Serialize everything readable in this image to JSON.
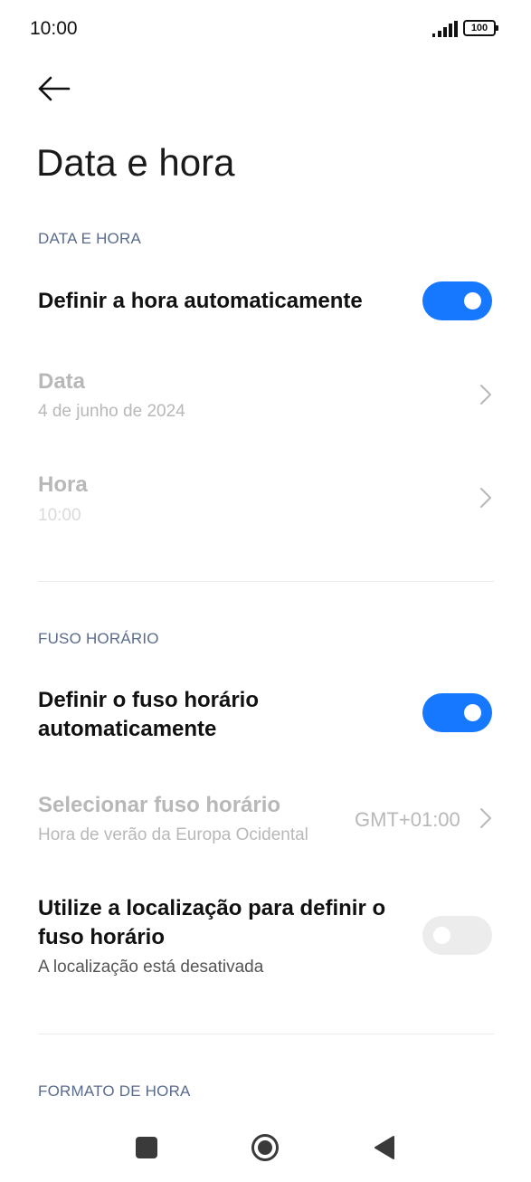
{
  "status_bar": {
    "time": "10:00",
    "battery": "100"
  },
  "page": {
    "title": "Data e hora"
  },
  "sections": {
    "date_time": {
      "header": "DATA E HORA",
      "auto_time": {
        "label": "Definir a hora automaticamente",
        "enabled": true
      },
      "date": {
        "label": "Data",
        "value": "4 de junho de 2024"
      },
      "time": {
        "label": "Hora",
        "value": "10:00"
      }
    },
    "time_zone": {
      "header": "FUSO HORÁRIO",
      "auto_zone": {
        "label_line1": "Definir o fuso horário",
        "label_line2": "automaticamente",
        "enabled": true
      },
      "select_zone": {
        "label": "Selecionar fuso horário",
        "sub": "Hora de verão da Europa Ocidental",
        "value": "GMT+01:00"
      },
      "use_location": {
        "label_line1": "Utilize a localização para definir o",
        "label_line2": "fuso horário",
        "sub": "A localização está desativada",
        "enabled": false
      }
    },
    "time_format": {
      "header": "FORMATO DE HORA"
    }
  },
  "colors": {
    "accent": "#1677ff",
    "section_header": "#5a6b8c",
    "disabled_text": "#b8b8b8"
  },
  "icons": {
    "back": "arrow-left-icon",
    "chevron": "chevron-right-icon",
    "signal": "signal-icon",
    "battery": "battery-icon"
  }
}
